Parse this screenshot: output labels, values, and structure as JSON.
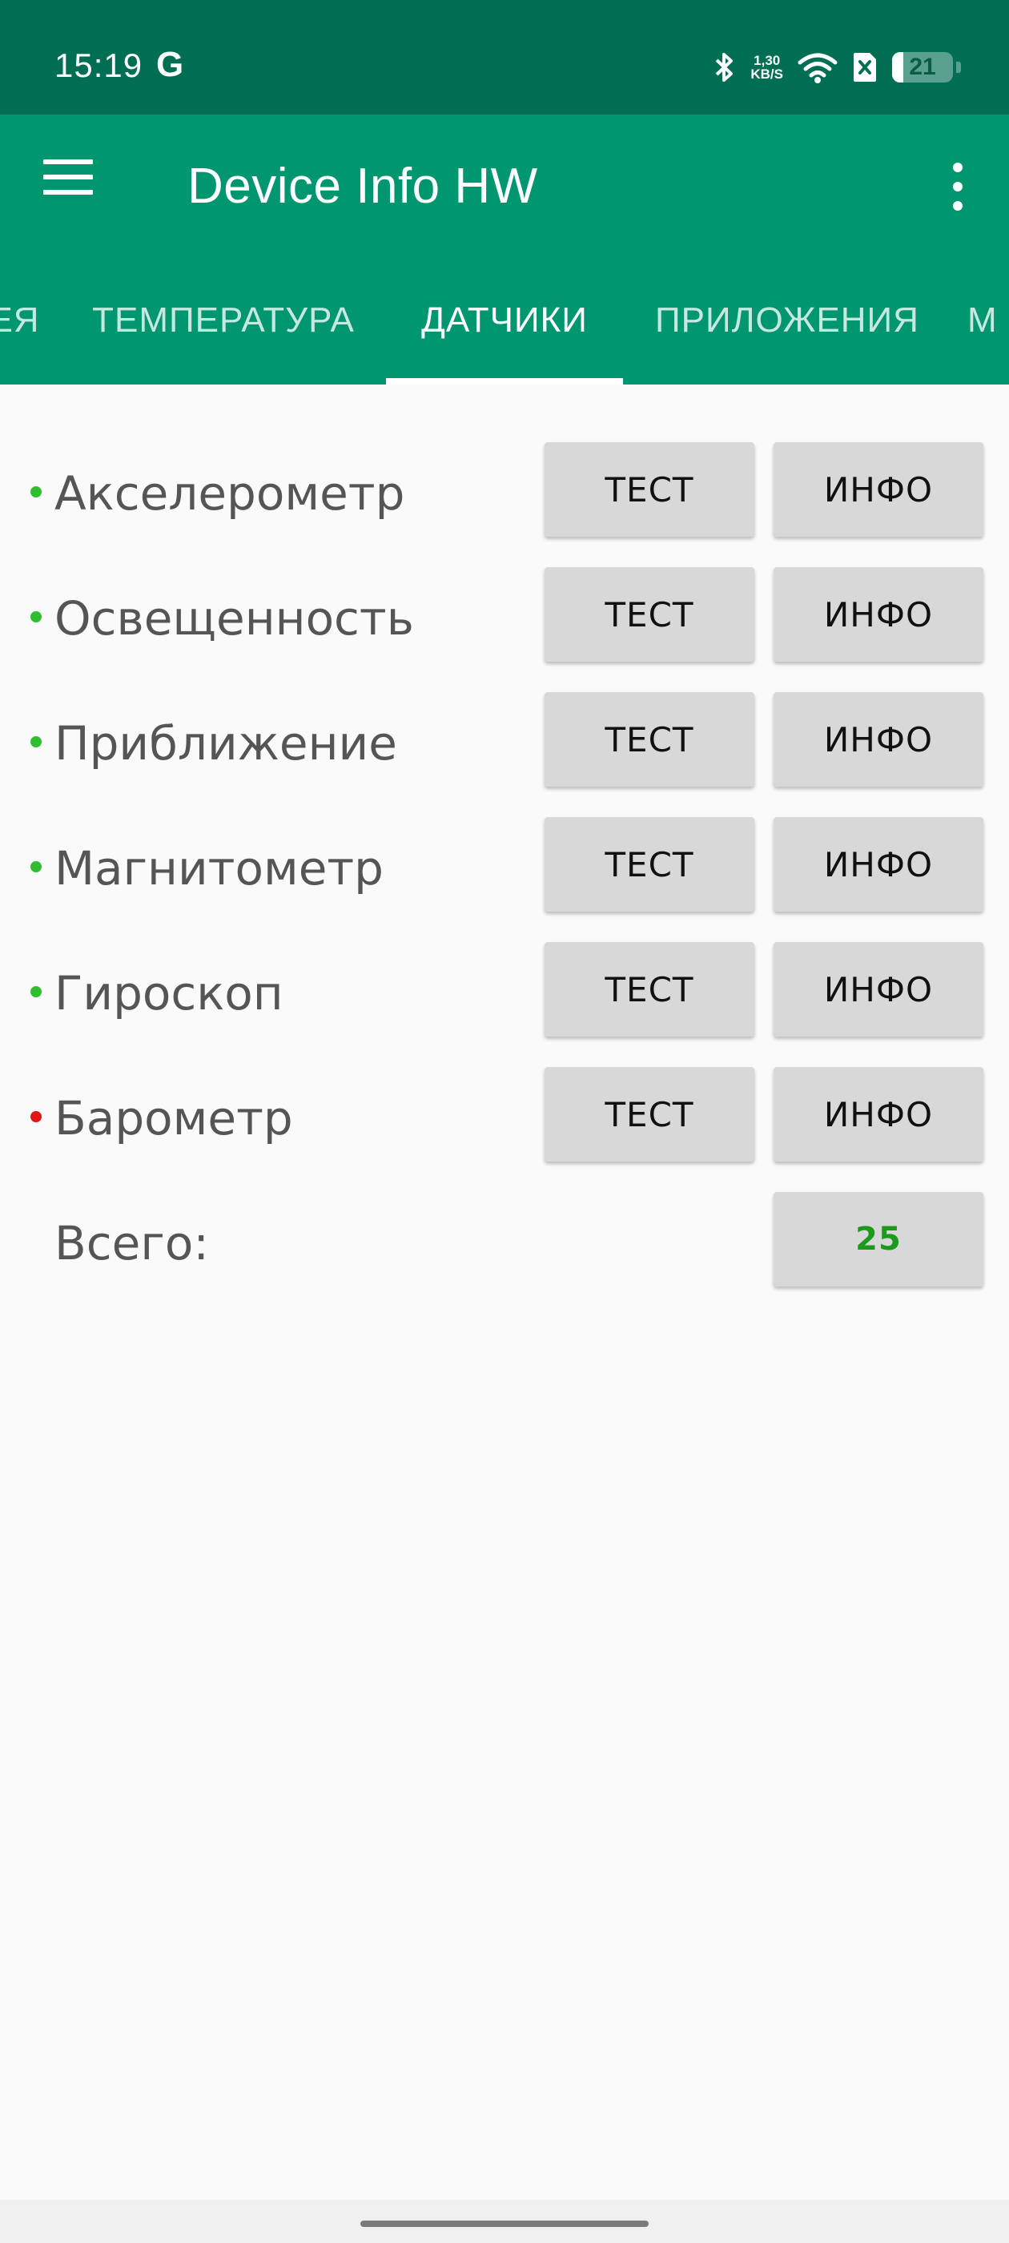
{
  "status_bar": {
    "time": "15:19",
    "g_label": "G",
    "net_speed_value": "1,30",
    "net_speed_unit": "KB/S",
    "battery": "21"
  },
  "app_bar": {
    "title": "Device Info HW"
  },
  "tabs": [
    {
      "label": "ЕЯ"
    },
    {
      "label": "ТЕМПЕРАТУРА"
    },
    {
      "label": "ДАТЧИКИ",
      "active": true
    },
    {
      "label": "ПРИЛОЖЕНИЯ"
    },
    {
      "label": "М"
    }
  ],
  "sensors": [
    {
      "name": "Акселерометр",
      "status": "green",
      "test_label": "ТЕСТ",
      "info_label": "ИНФО"
    },
    {
      "name": "Освещенность",
      "status": "green",
      "test_label": "ТЕСТ",
      "info_label": "ИНФО"
    },
    {
      "name": "Приближение",
      "status": "green",
      "test_label": "ТЕСТ",
      "info_label": "ИНФО"
    },
    {
      "name": "Магнитометр",
      "status": "green",
      "test_label": "ТЕСТ",
      "info_label": "ИНФО"
    },
    {
      "name": "Гироскоп",
      "status": "green",
      "test_label": "ТЕСТ",
      "info_label": "ИНФО"
    },
    {
      "name": "Барометр",
      "status": "red",
      "test_label": "ТЕСТ",
      "info_label": "ИНФО"
    }
  ],
  "total": {
    "label": "Всего:",
    "value": "25"
  },
  "colors": {
    "status_bar": "#006e53",
    "app_bar": "#009670",
    "ok": "#2fbe2f",
    "missing": "#e01616",
    "total_value": "#1b9a1b"
  }
}
